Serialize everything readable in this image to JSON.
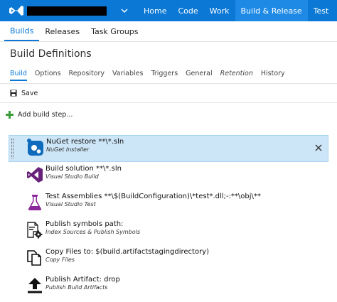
{
  "topbar": {
    "nav": [
      {
        "label": "Home",
        "active": false
      },
      {
        "label": "Code",
        "active": false
      },
      {
        "label": "Work",
        "active": false
      },
      {
        "label": "Build & Release",
        "active": true
      },
      {
        "label": "Test",
        "active": false
      }
    ]
  },
  "subtabs": [
    {
      "label": "Builds",
      "active": true
    },
    {
      "label": "Releases",
      "active": false
    },
    {
      "label": "Task Groups",
      "active": false
    }
  ],
  "page_title": "Build Definitions",
  "definition_tabs": [
    {
      "label": "Build",
      "active": true,
      "italic": false
    },
    {
      "label": "Options",
      "active": false,
      "italic": false
    },
    {
      "label": "Repository",
      "active": false,
      "italic": false
    },
    {
      "label": "Variables",
      "active": false,
      "italic": false
    },
    {
      "label": "Triggers",
      "active": false,
      "italic": false
    },
    {
      "label": "General",
      "active": false,
      "italic": false
    },
    {
      "label": "Retention",
      "active": false,
      "italic": true
    },
    {
      "label": "History",
      "active": false,
      "italic": false
    }
  ],
  "toolbar": {
    "save_label": "Save"
  },
  "add_step_label": "Add build step...",
  "steps": [
    {
      "name": "NuGet restore **\\*.sln",
      "type": "NuGet Installer",
      "icon": "nuget-icon",
      "selected": true
    },
    {
      "name": "Build solution **\\*.sln",
      "type": "Visual Studio Build",
      "icon": "visual-studio-icon",
      "selected": false
    },
    {
      "name": "Test Assemblies **\\$(BuildConfiguration)\\*test*.dll;-:**\\obj\\**",
      "type": "Visual Studio Test",
      "icon": "flask-icon",
      "selected": false
    },
    {
      "name": "Publish symbols path:",
      "type": "Index Sources & Publish Symbols",
      "icon": "publish-symbols-icon",
      "selected": false
    },
    {
      "name": "Copy Files to: $(build.artifactstagingdirectory)",
      "type": "Copy Files",
      "icon": "copy-files-icon",
      "selected": false
    },
    {
      "name": "Publish Artifact: drop",
      "type": "Publish Build Artifacts",
      "icon": "upload-icon",
      "selected": false
    }
  ],
  "colors": {
    "accent": "#0a78d4",
    "selected_row": "#cde6f7",
    "add_icon": "#3a9b3a",
    "vs_purple": "#68217a",
    "flask_purple": "#8a2a9a"
  }
}
